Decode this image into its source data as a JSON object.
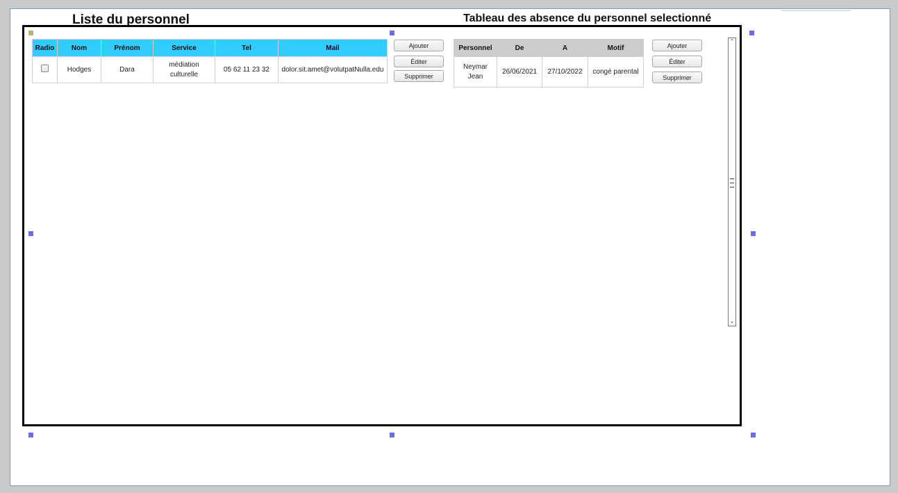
{
  "titles": {
    "personnel_list": "Liste du personnel",
    "absence_table": "Tableau des absence du personnel selectionné"
  },
  "personnel_table": {
    "headers": [
      "Radio",
      "Nom",
      "Prénom",
      "Service",
      "Tel",
      "Mail"
    ],
    "rows": [
      {
        "checked": false,
        "nom": "Hodges",
        "prenom": "Dara",
        "service_line1": "médiation",
        "service_line2": "culturelle",
        "tel": "05 62 11 23 32",
        "mail": "dolor.sit.amet@volutpatNulla.edu"
      }
    ]
  },
  "personnel_buttons": {
    "add": "Ajouter",
    "edit": "Éditer",
    "delete": "Supprimer"
  },
  "absence_table": {
    "headers": [
      "Personnel",
      "De",
      "A",
      "Motif"
    ],
    "rows": [
      {
        "personnel_line1": "Neymar",
        "personnel_line2": "Jean",
        "de": "26/06/2021",
        "a": "27/10/2022",
        "motif": "congé parental"
      }
    ]
  },
  "absence_buttons": {
    "add": "Ajouter",
    "edit": "Éditer",
    "delete": "Supprimer"
  },
  "colors": {
    "personnel_header": "#33ccff",
    "absence_header": "#cccccc",
    "selection_handle": "#6b6bf0"
  },
  "icons": [
    "checkbox-icon",
    "scroll-up-icon",
    "scroll-down-icon",
    "scroll-grip-icon"
  ]
}
